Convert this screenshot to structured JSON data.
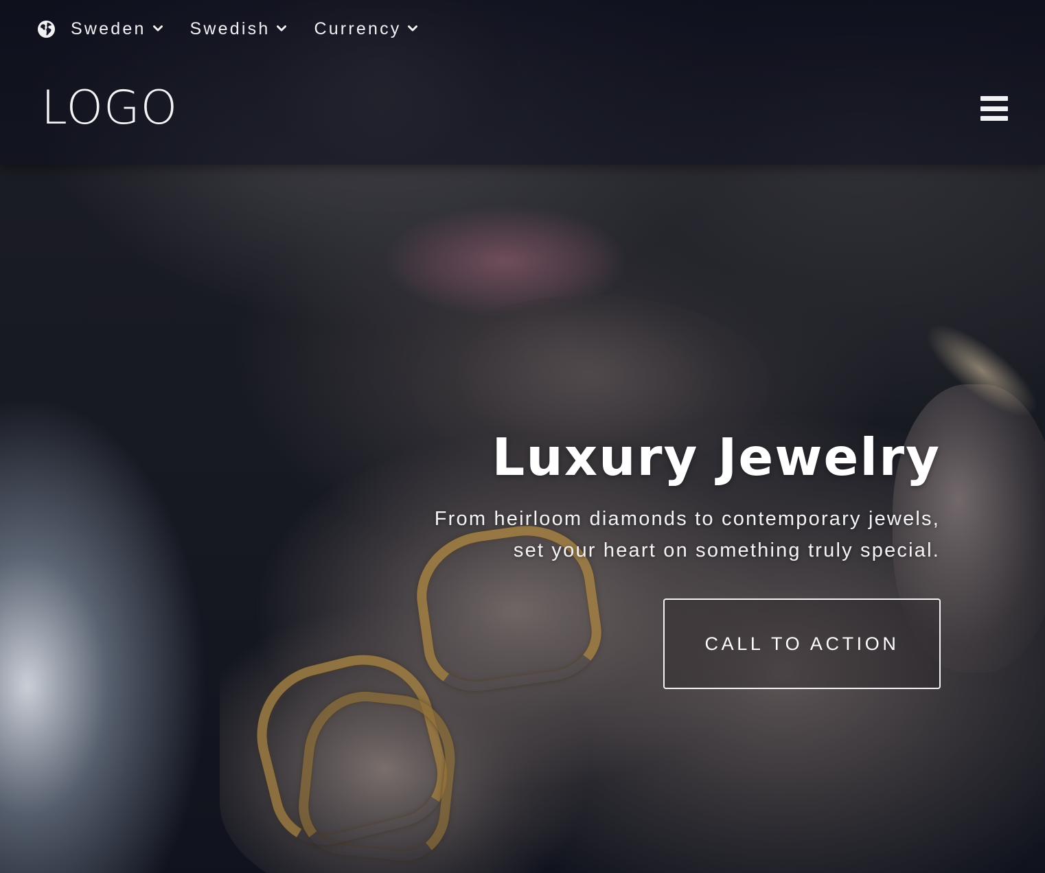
{
  "topbar": {
    "icon": "globe-icon",
    "country": "Sweden",
    "language": "Swedish",
    "currency": "Currency",
    "dropdown_icon": "chevron-down-icon"
  },
  "header": {
    "logo_text": "LOGO",
    "menu_icon": "hamburger-menu-icon"
  },
  "hero": {
    "title": "Luxury Jewelry",
    "subtitle_line1": "From heirloom diamonds to contemporary jewels,",
    "subtitle_line2": "set your heart on something truly special.",
    "cta_label": "CALL TO ACTION"
  },
  "colors": {
    "header_bg": "#0a0c1a",
    "text": "#ffffff",
    "ring_gold": "#b08a48"
  }
}
